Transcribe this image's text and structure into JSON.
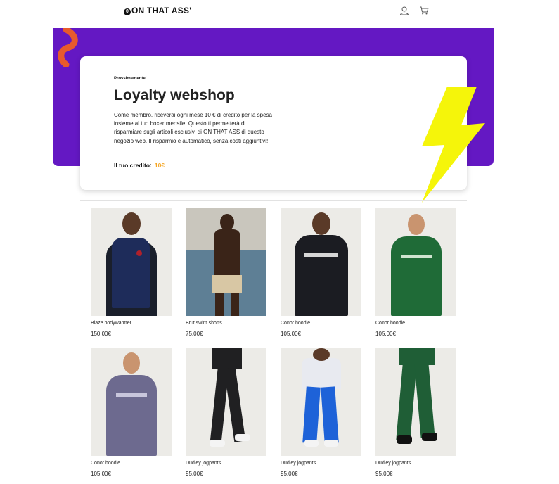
{
  "header": {
    "logo_text": "ON THAT ASS'",
    "logo_mark": "0",
    "icons": [
      "user-icon",
      "cart-icon"
    ]
  },
  "hero": {
    "eyebrow": "Prossimamente!",
    "title": "Loyalty webshop",
    "description": "Come membro, riceverai ogni mese 10 € di credito per la spesa insieme al tuo boxer mensile. Questo ti permetterà di risparmiare sugli articoli esclusivi di ON THAT ASS di questo negozio web. Il risparmio è automatico, senza costi aggiuntivi!",
    "credit_label": "Il tuo credito:",
    "credit_value": "10€"
  },
  "colors": {
    "hero_bg": "#6418c3",
    "accent_orange": "#e85a2c",
    "bolt_yellow": "#f5f50a",
    "credit_color": "#f5a623"
  },
  "products": [
    {
      "name": "Blaze bodywarmer",
      "price": "150,00€"
    },
    {
      "name": "Brut swim shorts",
      "price": "75,00€"
    },
    {
      "name": "Conor hoodie",
      "price": "105,00€"
    },
    {
      "name": "Conor hoodie",
      "price": "105,00€"
    },
    {
      "name": "Conor hoodie",
      "price": "105,00€"
    },
    {
      "name": "Dudley jogpants",
      "price": "95,00€"
    },
    {
      "name": "Dudley jogpants",
      "price": "95,00€"
    },
    {
      "name": "Dudley jogpants",
      "price": "95,00€"
    }
  ]
}
